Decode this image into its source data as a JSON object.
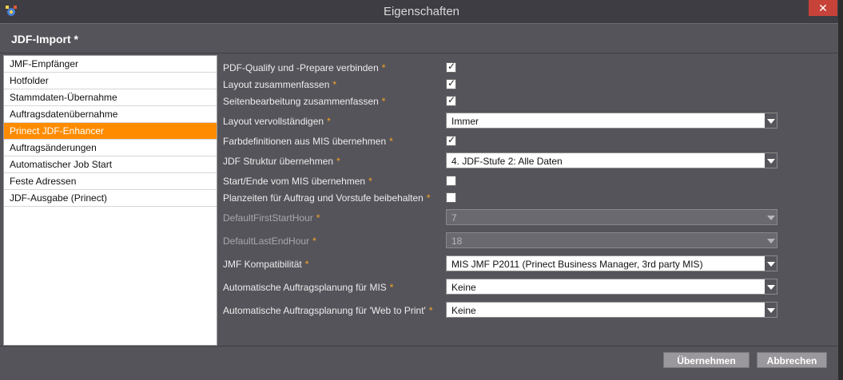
{
  "window": {
    "title": "Eigenschaften",
    "close_glyph": "✕",
    "app_icon": "gear-app-icon"
  },
  "header": {
    "title": "JDF-Import *"
  },
  "nav": {
    "items": [
      {
        "label": "JMF-Empfänger",
        "active": false
      },
      {
        "label": "Hotfolder",
        "active": false
      },
      {
        "label": "Stammdaten-Übernahme",
        "active": false
      },
      {
        "label": "Auftragsdatenübernahme",
        "active": false
      },
      {
        "label": "Prinect JDF-Enhancer",
        "active": true
      },
      {
        "label": "Auftragsänderungen",
        "active": false
      },
      {
        "label": "Automatischer Job Start",
        "active": false
      },
      {
        "label": "Feste Adressen",
        "active": false
      },
      {
        "label": "JDF-Ausgabe (Prinect)",
        "active": false
      }
    ]
  },
  "form": {
    "star": "*",
    "rows": [
      {
        "label": "PDF-Qualify und -Prepare verbinden",
        "type": "checkbox",
        "checked": true
      },
      {
        "label": "Layout zusammenfassen",
        "type": "checkbox",
        "checked": true
      },
      {
        "label": "Seitenbearbeitung zusammenfassen",
        "type": "checkbox",
        "checked": true
      },
      {
        "label": "Layout vervollständigen",
        "type": "select",
        "value": "Immer"
      },
      {
        "label": "Farbdefinitionen aus MIS übernehmen",
        "type": "checkbox",
        "checked": true
      },
      {
        "label": "JDF Struktur übernehmen",
        "type": "select",
        "value": "4. JDF-Stufe 2: Alle Daten"
      },
      {
        "label": "Start/Ende vom MIS übernehmen",
        "type": "checkbox",
        "checked": false
      },
      {
        "label": "Planzeiten für Auftrag und Vorstufe beibehalten",
        "type": "checkbox",
        "checked": false
      },
      {
        "label": "DefaultFirstStartHour",
        "type": "select",
        "value": "7",
        "disabled": true
      },
      {
        "label": "DefaultLastEndHour",
        "type": "select",
        "value": "18",
        "disabled": true
      },
      {
        "label": "JMF Kompatibilität",
        "type": "select",
        "value": "MIS JMF P2011 (Prinect Business Manager, 3rd party MIS)"
      },
      {
        "label": "Automatische Auftragsplanung für MIS",
        "type": "select",
        "value": "Keine"
      },
      {
        "label": "Automatische Auftragsplanung für 'Web to Print'",
        "type": "select",
        "value": "Keine"
      }
    ]
  },
  "footer": {
    "apply_label": "Übernehmen",
    "cancel_label": "Abbrechen"
  },
  "colors": {
    "accent": "#ff8c00",
    "close": "#c7433a",
    "star": "#f6a623",
    "background": "#56545b"
  }
}
